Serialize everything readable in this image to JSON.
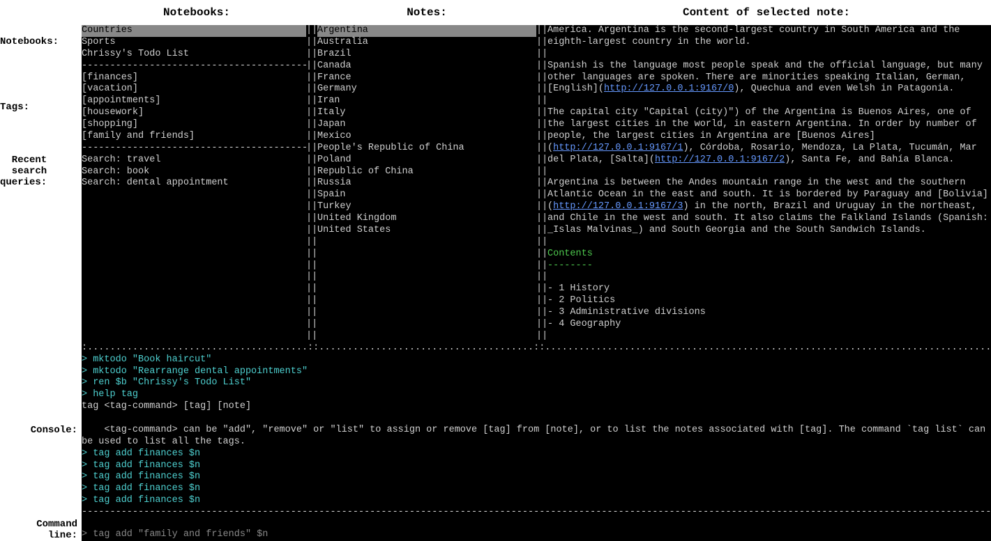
{
  "headers": {
    "notebooks": "Notebooks:",
    "notes": "Notes:",
    "content": "Content of selected note:"
  },
  "side_labels": {
    "notebooks": "Notebooks:",
    "tags": "Tags:",
    "recent_search": "Recent search queries:",
    "console": "Console:",
    "command_line": "Command line:"
  },
  "notebooks": {
    "items": [
      "Countries",
      "Sports",
      "Chrissy's Todo List"
    ],
    "selected_index": 0
  },
  "tags": [
    "[finances]",
    "[vacation]",
    "[appointments]",
    "[housework]",
    "[shopping]",
    "[family and friends]"
  ],
  "searches": [
    "Search: travel",
    "Search: book",
    "Search: dental appointment"
  ],
  "notes": {
    "items": [
      "Argentina",
      "Australia",
      "Brazil",
      "Canada",
      "France",
      "Germany",
      "Iran",
      "Italy",
      "Japan",
      "Mexico",
      "People's Republic of China",
      "Poland",
      "Republic of China",
      "Russia",
      "Spain",
      "Turkey",
      "United Kingdom",
      "United States"
    ],
    "selected_index": 0
  },
  "content": {
    "para1": "America. Argentina is the second-largest country in South America and the eighth-largest country in the world.",
    "para2_a": "Spanish is the language most people speak and the official language, but many other languages are spoken. There are minorities speaking Italian, German, [English](",
    "para2_link1": "http://127.0.0.1:9167/0",
    "para2_b": "), Quechua and even Welsh in Patagonia.",
    "para3_a": "The capital city \"Capital (city)\") of the Argentina is Buenos Aires, one of the largest cities in the world, in eastern Argentina. In order by number of people, the largest cities in Argentina are [Buenos Aires](",
    "para3_link1": "http://127.0.0.1:9167/1",
    "para3_b": "), Córdoba, Rosario, Mendoza, La Plata, Tucumán, Mar del Plata, [Salta](",
    "para3_link2": "http://127.0.0.1:9167/2",
    "para3_c": "), Santa Fe, and Bahía Blanca.",
    "para4_a": "Argentina is between the Andes mountain range in the west and the southern Atlantic Ocean in the east and south. It is bordered by Paraguay and [Bolivia](",
    "para4_link1": "http://127.0.0.1:9167/3",
    "para4_b": ") in the north, Brazil and Uruguay in the northeast, and Chile in the west and south. It also claims the Falkland Islands (Spanish: _Islas Malvinas_) and South Georgia and the South Sandwich Islands.",
    "contents_heading": "Contents",
    "contents_dashes": "--------",
    "toc": [
      "- 1 History",
      "- 2 Politics",
      "- 3 Administrative divisions",
      "- 4 Geography"
    ]
  },
  "console": {
    "history": [
      {
        "prompt": "> ",
        "cmd": "mktodo \"Book haircut\""
      },
      {
        "prompt": "> ",
        "cmd": "mktodo \"Rearrange dental appointments\""
      },
      {
        "prompt": "> ",
        "cmd": "ren $b \"Chrissy's Todo List\""
      },
      {
        "prompt": "> ",
        "cmd": "help tag"
      }
    ],
    "help_line1": "tag <tag-command> [tag] [note]",
    "help_line2": "    <tag-command> can be \"add\", \"remove\" or \"list\" to assign or remove [tag] from [note], or to list the notes associated with [tag]. The command `tag list` can be used to list all the tags.",
    "history2": [
      {
        "prompt": "> ",
        "cmd": "tag add finances $n"
      },
      {
        "prompt": "> ",
        "cmd": "tag add finances $n"
      },
      {
        "prompt": "> ",
        "cmd": "tag add finances $n"
      },
      {
        "prompt": "> ",
        "cmd": "tag add finances $n"
      },
      {
        "prompt": "> ",
        "cmd": "tag add finances $n"
      }
    ]
  },
  "command_line": {
    "prompt": "> ",
    "input": "tag add \"family and friends\" $n"
  }
}
